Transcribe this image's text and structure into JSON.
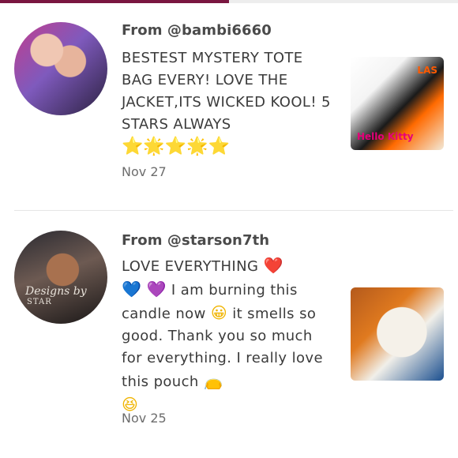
{
  "reviews": [
    {
      "from": "From @bambi6660",
      "text": "BESTEST MYSTERY TOTE BAG EVERY! LOVE THE JACKET,ITS WICKED KOOL! 5 STARS ALWAYS",
      "stars": "⭐🌟⭐🌟⭐",
      "date": "Nov 27",
      "avatar": {
        "icon": "profile-photo"
      },
      "photo": {
        "icon": "tote-bags-photo",
        "visible_text_1": "Hello Kitty",
        "visible_text_2": "LAS"
      }
    },
    {
      "from": "From @starson7th",
      "text_1": "LOVE EVERYTHING",
      "text_2": "I am burning this candle now",
      "text_3": "it smells so good. Thank you so much for everything. I really love this pouch",
      "emojis": {
        "heart_red": "❤️",
        "heart_blue": "💙",
        "heart_purple": "💜",
        "smile": "😀",
        "pouch": "👝",
        "laugh": "😆"
      },
      "date": "Nov 25",
      "avatar": {
        "caption": "Designs by",
        "caption_small": "STAR",
        "icon": "profile-photo"
      },
      "photo": {
        "icon": "pouch-photo"
      }
    }
  ],
  "colors": {
    "tab_active": "#7a1640",
    "divider": "#e6e6e6"
  }
}
